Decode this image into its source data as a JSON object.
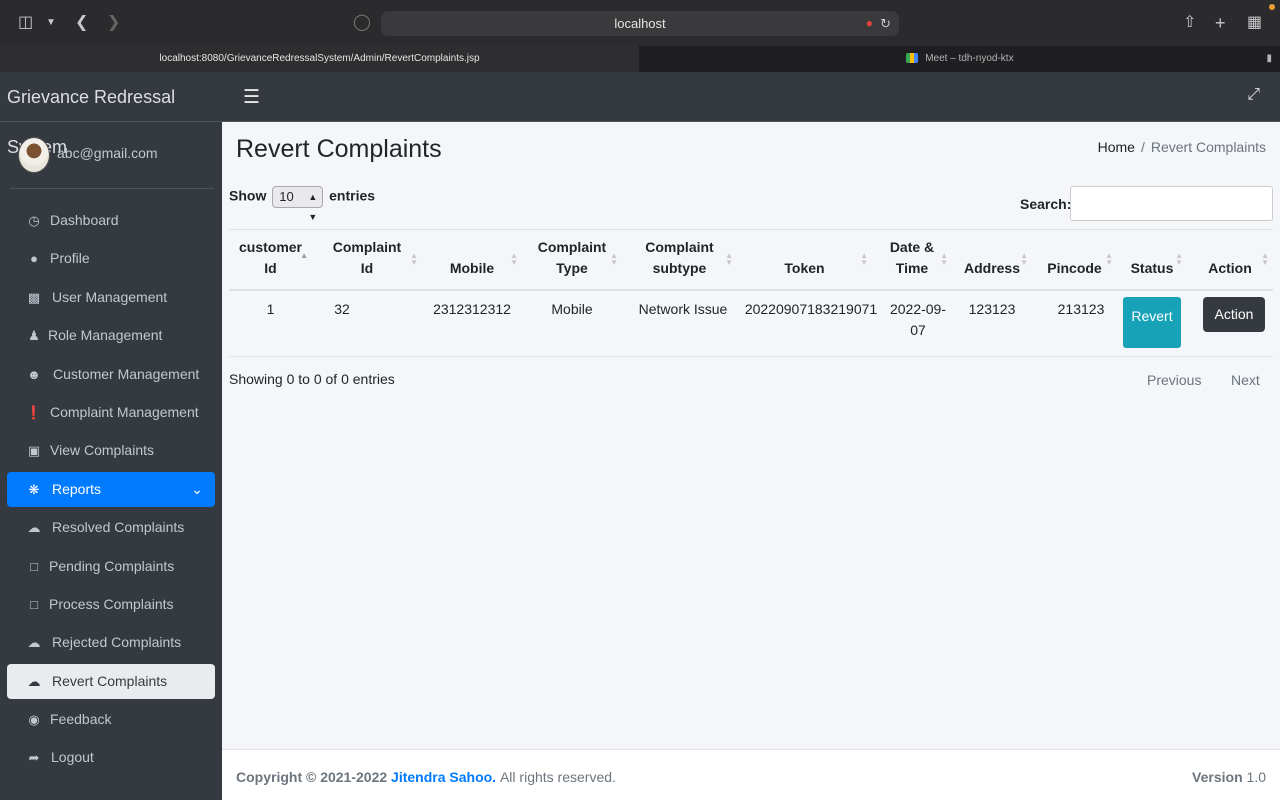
{
  "browser": {
    "address": "localhost",
    "tabs": [
      {
        "title": "localhost:8080/GrievanceRedressalSystem/Admin/RevertComplaints.jsp"
      },
      {
        "title": "Meet – tdh-nyod-ktx"
      }
    ],
    "icons": [
      "sidebar-toggle-icon",
      "chevron-down-icon",
      "back-icon",
      "forward-icon",
      "shield-icon",
      "mic-icon",
      "reload-icon",
      "share-icon",
      "new-tab-icon",
      "tab-overview-icon"
    ]
  },
  "sidebar": {
    "brand": "Grievance Redressal System",
    "user": "abc@gmail.com",
    "items": [
      {
        "label": "Dashboard",
        "icon": "dashboard-icon"
      },
      {
        "label": "Profile",
        "icon": "user-icon"
      },
      {
        "label": "User Management",
        "icon": "sitemap-icon"
      },
      {
        "label": "Role Management",
        "icon": "user-tie-icon"
      },
      {
        "label": "Customer Management",
        "icon": "users-icon"
      },
      {
        "label": "Complaint Management",
        "icon": "exclamation-circle-icon"
      },
      {
        "label": "View Complaints",
        "icon": "inbox-icon"
      },
      {
        "label": "Reports",
        "icon": "bug-icon",
        "state": "open"
      },
      {
        "label": "Resolved Complaints",
        "icon": "cloudflare-icon"
      },
      {
        "label": "Pending Complaints",
        "icon": "file-icon"
      },
      {
        "label": "Process Complaints",
        "icon": "file-icon"
      },
      {
        "label": "Rejected Complaints",
        "icon": "cloudflare-icon"
      },
      {
        "label": "Revert Complaints",
        "icon": "cloudflare-icon",
        "state": "current"
      },
      {
        "label": "Feedback",
        "icon": "comment-icon"
      },
      {
        "label": "Logout",
        "icon": "sign-out-icon"
      }
    ]
  },
  "header": {
    "title": "Revert Complaints",
    "breadcrumb": {
      "home": "Home",
      "separator": "/",
      "current": "Revert Complaints"
    }
  },
  "table_controls": {
    "show": "Show",
    "length": "10",
    "entries": "entries",
    "search_label": "Search:",
    "search_value": ""
  },
  "table": {
    "headers": [
      {
        "l1": "customer",
        "l2": "Id",
        "sort": "asc"
      },
      {
        "l1": "Complaint",
        "l2": "Id",
        "sort": "both"
      },
      {
        "l1": "",
        "l2": "Mobile",
        "sort": "both"
      },
      {
        "l1": "Complaint",
        "l2": "Type",
        "sort": "both"
      },
      {
        "l1": "Complaint",
        "l2": "subtype",
        "sort": "both"
      },
      {
        "l1": "",
        "l2": "Token",
        "sort": "both"
      },
      {
        "l1": "Date &",
        "l2": "Time",
        "sort": "both"
      },
      {
        "l1": "",
        "l2": "Address",
        "sort": "both"
      },
      {
        "l1": "",
        "l2": "Pincode",
        "sort": "both"
      },
      {
        "l1": "",
        "l2": "Status",
        "sort": "both"
      },
      {
        "l1": "",
        "l2": "Action",
        "sort": "both"
      }
    ],
    "rows": [
      {
        "customer_id": "1",
        "complaint_id": "32",
        "mobile": "2312312312",
        "type": "Mobile",
        "subtype": "Network Issue",
        "token": "20220907183219071",
        "date_l1": "2022-09-",
        "date_l2": "07",
        "address": "123123",
        "pincode": "213123",
        "status_button": "Revert",
        "action_button": "Action"
      }
    ],
    "info": "Showing 0 to 0 of 0 entries",
    "previous": "Previous",
    "next": "Next"
  },
  "footer": {
    "copyright": "Copyright © 2021-2022",
    "author": "Jitendra Sahoo.",
    "rights": "All rights reserved.",
    "version_label": "Version",
    "version": "1.0"
  },
  "colors": {
    "sidebar_bg": "#343a40",
    "content_bg": "#f4f6f9",
    "primary": "#007bff",
    "info": "#17a2b8",
    "dark": "#343a40"
  }
}
